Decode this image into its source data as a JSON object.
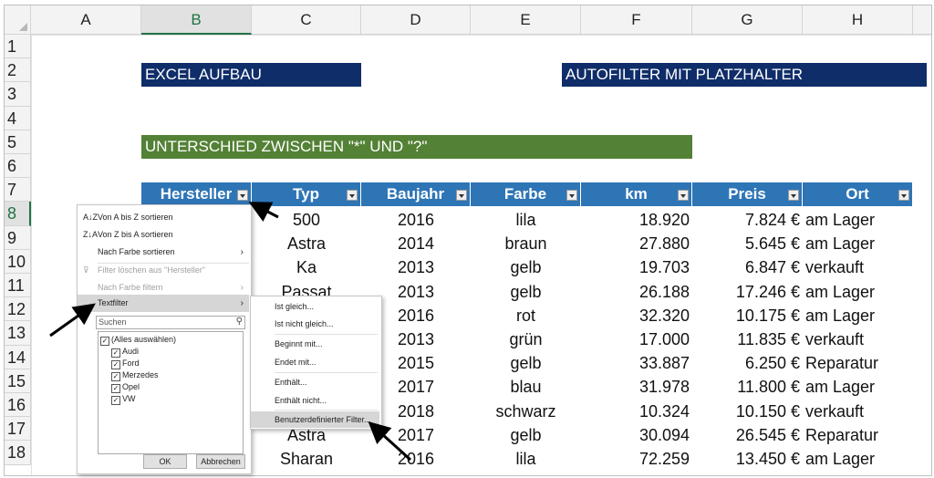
{
  "columns": [
    "A",
    "B",
    "C",
    "D",
    "E",
    "F",
    "G",
    "H"
  ],
  "rows": [
    "1",
    "2",
    "3",
    "4",
    "5",
    "6",
    "7",
    "8",
    "9",
    "10",
    "11",
    "12",
    "13",
    "14",
    "15",
    "16",
    "17",
    "18"
  ],
  "banners": {
    "excel_aufbau": "EXCEL AUFBAU",
    "autofilter": "AUTOFILTER MIT PLATZHALTER",
    "unterschied": "UNTERSCHIED ZWISCHEN \"*\" UND \"?\""
  },
  "table": {
    "headers": [
      "Hersteller",
      "Typ",
      "Baujahr",
      "Farbe",
      "km",
      "Preis",
      "Ort"
    ],
    "rows": [
      [
        "",
        "500",
        "2016",
        "lila",
        "18.920",
        "7.824 €",
        "am Lager"
      ],
      [
        "",
        "Astra",
        "2014",
        "braun",
        "27.880",
        "5.645 €",
        "am Lager"
      ],
      [
        "",
        "Ka",
        "2013",
        "gelb",
        "19.703",
        "6.847 €",
        "verkauft"
      ],
      [
        "",
        "Passat",
        "2013",
        "gelb",
        "26.188",
        "17.246 €",
        "am Lager"
      ],
      [
        "",
        "",
        "2016",
        "rot",
        "32.320",
        "10.175 €",
        "am Lager"
      ],
      [
        "",
        "",
        "2013",
        "grün",
        "17.000",
        "11.835 €",
        "verkauft"
      ],
      [
        "",
        "",
        "2015",
        "gelb",
        "33.887",
        "6.250 €",
        "Reparatur"
      ],
      [
        "",
        "",
        "2017",
        "blau",
        "31.978",
        "11.800 €",
        "am Lager"
      ],
      [
        "",
        "",
        "2018",
        "schwarz",
        "10.324",
        "10.150 €",
        "verkauft"
      ],
      [
        "",
        "Astra",
        "2017",
        "gelb",
        "30.094",
        "26.545 €",
        "Reparatur"
      ],
      [
        "",
        "Sharan",
        "2016",
        "lila",
        "72.259",
        "13.450 €",
        "am Lager"
      ]
    ]
  },
  "filter_menu": {
    "items": [
      {
        "label": "Von A bis Z sortieren",
        "icon": "A↓Z"
      },
      {
        "label": "Von Z bis A sortieren",
        "icon": "Z↓A"
      },
      {
        "label": "Nach Farbe sortieren",
        "icon": ""
      },
      {
        "label": "Filter löschen aus \"Hersteller\"",
        "icon": "⊽"
      },
      {
        "label": "Nach Farbe filtern",
        "icon": ""
      },
      {
        "label": "Textfilter",
        "icon": ""
      }
    ],
    "search_placeholder": "Suchen",
    "checkboxes": [
      "(Alles auswählen)",
      "Audi",
      "Ford",
      "Merzedes",
      "Opel",
      "VW"
    ],
    "ok_label": "OK",
    "cancel_label": "Abbrechen"
  },
  "submenu": {
    "items": [
      "Ist gleich...",
      "Ist nicht gleich...",
      "Beginnt mit...",
      "Endet mit...",
      "Enthält...",
      "Enthält nicht...",
      "Benutzerdefinierter Filter..."
    ]
  },
  "colors": {
    "navy": "#0f2d69",
    "green": "#538135",
    "table_header": "#2e75b6",
    "excel_green": "#217346"
  }
}
